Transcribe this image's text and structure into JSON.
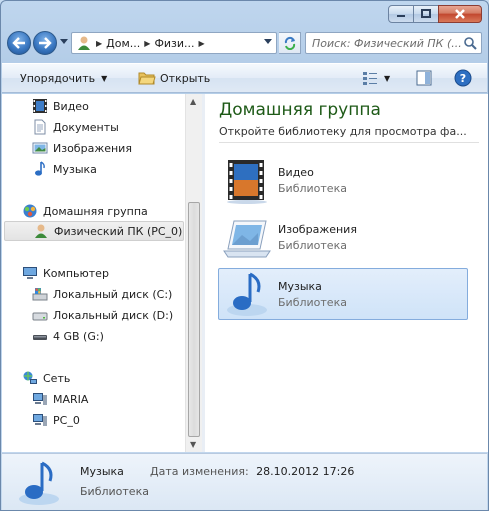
{
  "window": {
    "caption_buttons": [
      "minimize",
      "maximize",
      "close"
    ]
  },
  "address_bar": {
    "crumbs": [
      "Дом...",
      "Физи..."
    ],
    "search_placeholder": "Поиск: Физический ПК (..."
  },
  "toolbar": {
    "organize_label": "Упорядочить",
    "open_label": "Открыть"
  },
  "nav": {
    "libraries": [
      {
        "label": "Видео",
        "icon": "video-icon"
      },
      {
        "label": "Документы",
        "icon": "documents-icon"
      },
      {
        "label": "Изображения",
        "icon": "pictures-icon"
      },
      {
        "label": "Музыка",
        "icon": "music-icon"
      }
    ],
    "homegroup": {
      "label": "Домашняя группа",
      "child": "Физический ПК (PC_0)"
    },
    "computer": {
      "label": "Компьютер",
      "drives": [
        "Локальный диск (C:)",
        "Локальный диск (D:)",
        "4 GB (G:)"
      ]
    },
    "network": {
      "label": "Сеть",
      "hosts": [
        "MARIA",
        "PC_0"
      ]
    }
  },
  "content": {
    "title": "Домашняя группа",
    "subtitle": "Откройте библиотеку для просмотра фа...",
    "libraries": [
      {
        "name": "Видео",
        "type": "Библиотека",
        "icon": "video-library-icon",
        "selected": false
      },
      {
        "name": "Изображения",
        "type": "Библиотека",
        "icon": "pictures-library-icon",
        "selected": false
      },
      {
        "name": "Музыка",
        "type": "Библиотека",
        "icon": "music-library-icon",
        "selected": true
      }
    ]
  },
  "details": {
    "name": "Музыка",
    "type": "Библиотека",
    "date_label": "Дата изменения:",
    "date_value": "28.10.2012 17:26"
  },
  "colors": {
    "title_green": "#1e5a17",
    "selection_blue": "#cfe3f8"
  }
}
